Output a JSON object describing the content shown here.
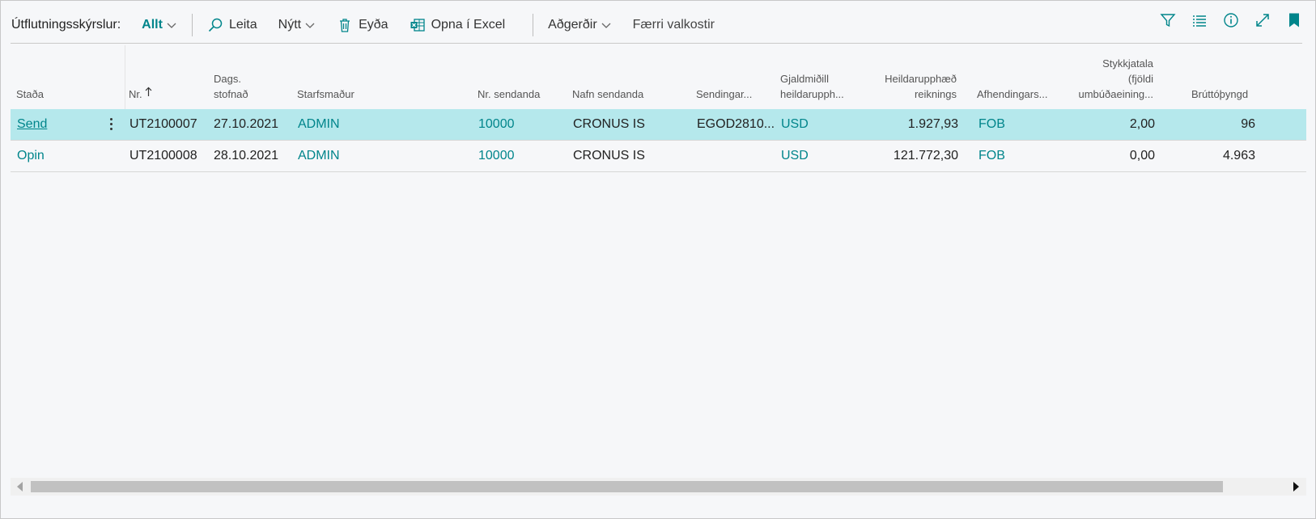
{
  "toolbar": {
    "title": "Útflutningsskýrslur:",
    "filter": "Allt",
    "actions": [
      {
        "label": "Leita",
        "icon": "search-icon"
      },
      {
        "label": "Nýtt",
        "icon": "chevron-down-icon"
      },
      {
        "label": "Eyða",
        "icon": "trash-icon"
      },
      {
        "label": "Opna í Excel",
        "icon": "excel-icon"
      },
      {
        "label": "Aðgerðir",
        "icon": "chevron-down-icon"
      },
      {
        "label": "Færri valkostir"
      }
    ],
    "right_icons": [
      "filter-icon",
      "list-view-icon",
      "info-icon",
      "expand-icon",
      "bookmark-icon"
    ]
  },
  "colors": {
    "accent": "#00858b",
    "selected_row": "#b5e8ec",
    "background": "#f6f7f9"
  },
  "table": {
    "headers": {
      "stada": "Staða",
      "nr": "Nr.",
      "dags_1": "Dags.",
      "dags_2": "stofnað",
      "starfsmadur": "Starfsmaður",
      "nr_sendanda": "Nr. sendanda",
      "nafn_sendanda": "Nafn sendanda",
      "sendingar": "Sendingar...",
      "gjaldmidill_1": "Gjaldmiðill",
      "gjaldmidill_2": "heildarupph...",
      "heildar_1": "Heildarupphæð",
      "heildar_2": "reiknings",
      "afhendingar": "Afhendingars...",
      "stykkja_1": "Stykkjatala",
      "stykkja_2": "(fjöldi",
      "stykkja_3": "umbúðaeining...",
      "brutto": "Brúttóþyngd"
    },
    "rows": [
      {
        "stada": "Send",
        "nr": "UT2100007",
        "dags": "27.10.2021",
        "starfsmadur": "ADMIN",
        "nr_sendanda": "10000",
        "nafn_sendanda": "CRONUS IS",
        "sendingar": "EGOD2810...",
        "gjaldmidill": "USD",
        "heildar": "1.927,93",
        "afhendingar": "FOB",
        "stykkja": "2,00",
        "brutto": "96"
      },
      {
        "stada": "Opin",
        "nr": "UT2100008",
        "dags": "28.10.2021",
        "starfsmadur": "ADMIN",
        "nr_sendanda": "10000",
        "nafn_sendanda": "CRONUS IS",
        "sendingar": "",
        "gjaldmidill": "USD",
        "heildar": "121.772,30",
        "afhendingar": "FOB",
        "stykkja": "0,00",
        "brutto": "4.963"
      }
    ]
  }
}
